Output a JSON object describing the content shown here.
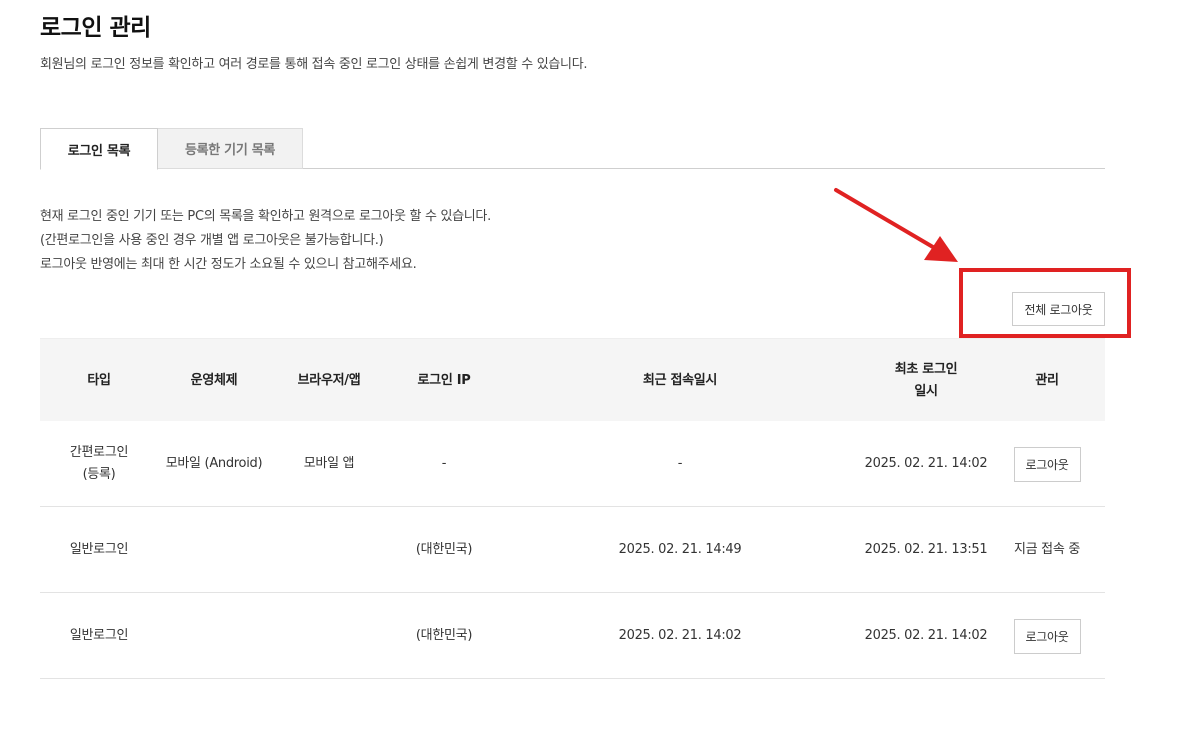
{
  "page": {
    "title": "로그인 관리",
    "description": "회원님의 로그인 정보를 확인하고 여러 경로를 통해 접속 중인 로그인 상태를 손쉽게 변경할 수 있습니다."
  },
  "tabs": [
    {
      "label": "로그인 목록",
      "active": true
    },
    {
      "label": "등록한 기기 목록",
      "active": false
    }
  ],
  "info": {
    "line1": "현재 로그인 중인 기기 또는 PC의 목록을 확인하고 원격으로 로그아웃 할 수 있습니다.",
    "line2": "(간편로그인을 사용 중인 경우 개별 앱 로그아웃은 불가능합니다.)",
    "line3": "로그아웃 반영에는 최대 한 시간 정도가 소요될 수 있으니 참고해주세요."
  },
  "logout_all_label": "전체 로그아웃",
  "annotation_color": "#e02222",
  "table": {
    "headers": {
      "type": "타입",
      "os": "운영체제",
      "browser": "브라우저/앱",
      "ip": "로그인 IP",
      "last": "최근 접속일시",
      "first_line1": "최초 로그인",
      "first_line2": "일시",
      "manage": "관리"
    },
    "rows": [
      {
        "type_line1": "간편로그인",
        "type_line2": "(등록)",
        "os": "모바일 (Android)",
        "browser": "모바일 앱",
        "ip_line1": "-",
        "ip_line2": "",
        "last": "-",
        "first": "2025. 02. 21. 14:02",
        "manage": "로그아웃",
        "manage_is_button": true
      },
      {
        "type_line1": "일반로그인",
        "type_line2": "",
        "os": "",
        "browser": "",
        "ip_line1": "",
        "ip_line2": "(대한민국)",
        "last": "2025. 02. 21. 14:49",
        "first": "2025. 02. 21. 13:51",
        "manage": "지금 접속 중",
        "manage_is_button": false
      },
      {
        "type_line1": "일반로그인",
        "type_line2": "",
        "os": "",
        "browser": "",
        "ip_line1": "",
        "ip_line2": "(대한민국)",
        "last": "2025. 02. 21. 14:02",
        "first": "2025. 02. 21. 14:02",
        "manage": "로그아웃",
        "manage_is_button": true
      }
    ]
  }
}
